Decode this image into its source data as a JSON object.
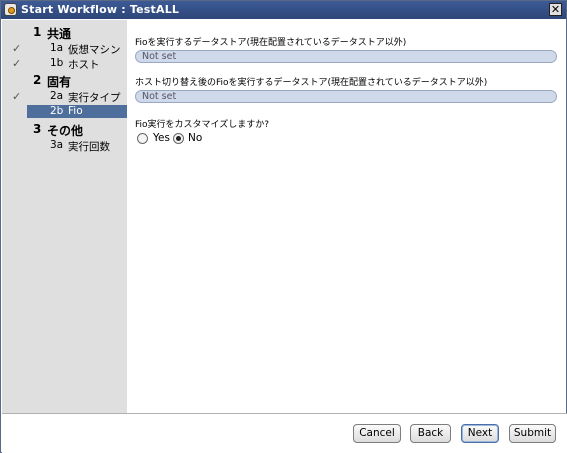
{
  "window": {
    "title": "Start Workflow : TestALL",
    "close_glyph": "✕"
  },
  "sidebar": {
    "groups": [
      {
        "num": "1",
        "label": "共通",
        "items": [
          {
            "code": "1a",
            "label": "仮想マシン",
            "checked": true,
            "check": "✓"
          },
          {
            "code": "1b",
            "label": "ホスト",
            "checked": true,
            "check": "✓"
          }
        ]
      },
      {
        "num": "2",
        "label": "固有",
        "items": [
          {
            "code": "2a",
            "label": "実行タイプ",
            "checked": true,
            "check": "✓"
          },
          {
            "code": "2b",
            "label": "Fio",
            "selected": true
          }
        ]
      },
      {
        "num": "3",
        "label": "その他",
        "items": [
          {
            "code": "3a",
            "label": "実行回数"
          }
        ]
      }
    ]
  },
  "form": {
    "q1_label": "Fioを実行するデータストア(現在配置されているデータストア以外)",
    "q1_value": "Not set",
    "q2_label": "ホスト切り替え後のFioを実行するデータストア(現在配置されているデータストア以外)",
    "q2_value": "Not set",
    "q3_label": "Fio実行をカスタマイズしますか?",
    "q3_options": [
      {
        "label": "Yes",
        "selected": false
      },
      {
        "label": "No",
        "selected": true
      }
    ]
  },
  "footer": {
    "cancel": "Cancel",
    "back": "Back",
    "next": "Next",
    "submit": "Submit"
  },
  "colors": {
    "titlebar": "#2e4678",
    "sidebar_bg": "#dfdfdf",
    "selected_item": "#4e6e9b",
    "field_bg": "#cfd9ea"
  }
}
